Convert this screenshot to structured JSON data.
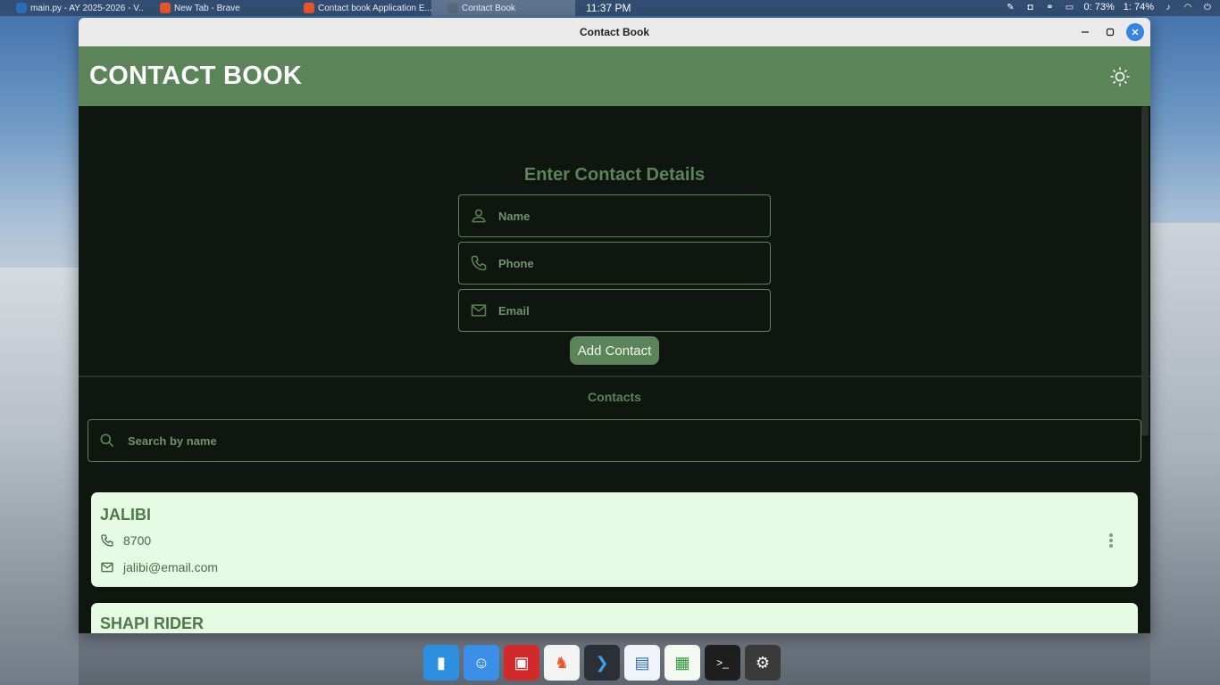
{
  "top_panel": {
    "tasks": [
      {
        "label": "main.py - AY 2025-2026 - V...",
        "color": "#2c6bb8"
      },
      {
        "label": "New Tab - Brave",
        "color": "#e8562a"
      },
      {
        "label": "Contact book Application E...",
        "color": "#e8562a"
      },
      {
        "label": "Contact Book",
        "color": "#5a6a7a"
      }
    ],
    "clock": "11:37 PM",
    "battery": "0: 73%",
    "battery2": "1: 74%"
  },
  "window": {
    "title": "Contact Book"
  },
  "app": {
    "title": "CONTACT BOOK",
    "form_title": "Enter Contact Details",
    "name_placeholder": "Name",
    "phone_placeholder": "Phone",
    "email_placeholder": "Email",
    "add_button": "Add Contact",
    "contacts_label": "Contacts",
    "search_placeholder": "Search by name",
    "contacts": [
      {
        "name": "JALIBI",
        "phone": "8700",
        "email": "jalibi@email.com"
      },
      {
        "name": "SHAPI RIDER"
      }
    ]
  },
  "colors": {
    "accent": "#5b8458",
    "background": "#0f150f",
    "card": "#e6fbe4"
  },
  "dock": [
    {
      "icon": "launcher-icon",
      "color": "#2d8fe0"
    },
    {
      "icon": "finder-icon",
      "color": "#3b8fe8"
    },
    {
      "icon": "photo-booth-icon",
      "color": "#d22a2a"
    },
    {
      "icon": "brave-icon",
      "color": "#f4f4f4"
    },
    {
      "icon": "vscode-icon",
      "color": "#2b2f36"
    },
    {
      "icon": "document-viewer-icon",
      "color": "#f0f4fa"
    },
    {
      "icon": "spreadsheet-icon",
      "color": "#f4faf2"
    },
    {
      "icon": "terminal-icon",
      "color": "#1e1e1e"
    },
    {
      "icon": "settings-icon",
      "color": "#3a3a3a"
    }
  ]
}
